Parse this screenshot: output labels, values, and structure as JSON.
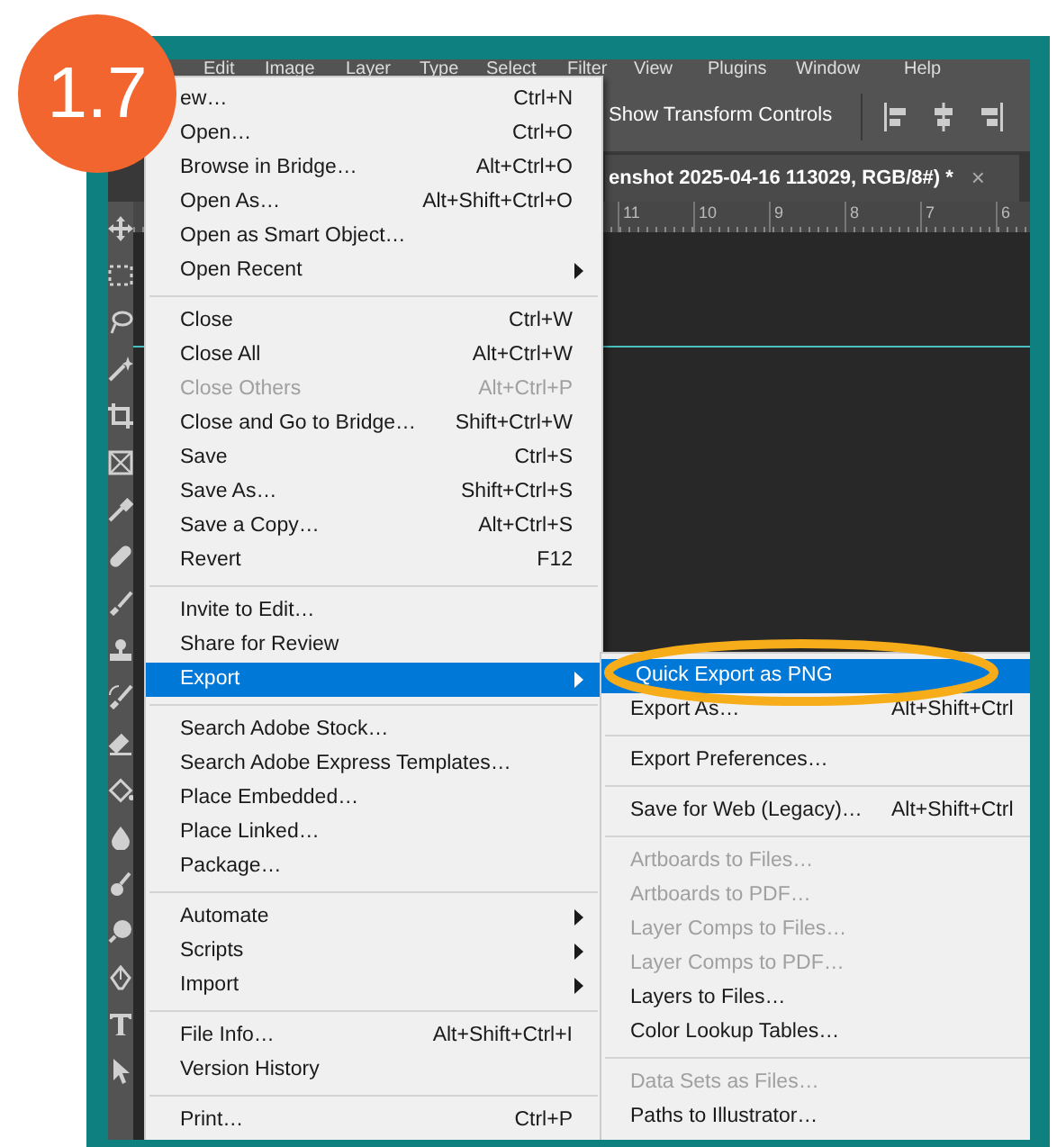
{
  "badge": "1.7",
  "menubar": [
    "Edit",
    "Image",
    "Layer",
    "Type",
    "Select",
    "Filter",
    "View",
    "Plugins",
    "Window",
    "Help"
  ],
  "options_bar": {
    "label": "Show Transform Controls"
  },
  "document_tab": {
    "title": "enshot 2025-04-16 113029, RGB/8#) *",
    "close": "×"
  },
  "ruler": [
    "11",
    "10",
    "9",
    "8",
    "7",
    "6"
  ],
  "file_menu": [
    {
      "kind": "item",
      "label": "ew…",
      "shortcut": "Ctrl+N",
      "submenu": false,
      "disabled": false,
      "selected": false
    },
    {
      "kind": "item",
      "label": "Open…",
      "shortcut": "Ctrl+O",
      "submenu": false,
      "disabled": false,
      "selected": false
    },
    {
      "kind": "item",
      "label": "Browse in Bridge…",
      "shortcut": "Alt+Ctrl+O",
      "submenu": false,
      "disabled": false,
      "selected": false
    },
    {
      "kind": "item",
      "label": "Open As…",
      "shortcut": "Alt+Shift+Ctrl+O",
      "submenu": false,
      "disabled": false,
      "selected": false
    },
    {
      "kind": "item",
      "label": "Open as Smart Object…",
      "submenu": false,
      "disabled": false,
      "selected": false
    },
    {
      "kind": "item",
      "label": "Open Recent",
      "submenu": true,
      "disabled": false,
      "selected": false
    },
    {
      "kind": "separator"
    },
    {
      "kind": "item",
      "label": "Close",
      "shortcut": "Ctrl+W",
      "submenu": false,
      "disabled": false,
      "selected": false
    },
    {
      "kind": "item",
      "label": "Close All",
      "shortcut": "Alt+Ctrl+W",
      "submenu": false,
      "disabled": false,
      "selected": false
    },
    {
      "kind": "item",
      "label": "Close Others",
      "shortcut": "Alt+Ctrl+P",
      "submenu": false,
      "disabled": true,
      "selected": false
    },
    {
      "kind": "item",
      "label": "Close and Go to Bridge…",
      "shortcut": "Shift+Ctrl+W",
      "submenu": false,
      "disabled": false,
      "selected": false
    },
    {
      "kind": "item",
      "label": "Save",
      "shortcut": "Ctrl+S",
      "submenu": false,
      "disabled": false,
      "selected": false
    },
    {
      "kind": "item",
      "label": "Save As…",
      "shortcut": "Shift+Ctrl+S",
      "submenu": false,
      "disabled": false,
      "selected": false
    },
    {
      "kind": "item",
      "label": "Save a Copy…",
      "shortcut": "Alt+Ctrl+S",
      "submenu": false,
      "disabled": false,
      "selected": false
    },
    {
      "kind": "item",
      "label": "Revert",
      "shortcut": "F12",
      "submenu": false,
      "disabled": false,
      "selected": false
    },
    {
      "kind": "separator"
    },
    {
      "kind": "item",
      "label": "Invite to Edit…",
      "submenu": false,
      "disabled": false,
      "selected": false
    },
    {
      "kind": "item",
      "label": "Share for Review",
      "submenu": false,
      "disabled": false,
      "selected": false
    },
    {
      "kind": "item",
      "label": "Export",
      "submenu": true,
      "disabled": false,
      "selected": true
    },
    {
      "kind": "separator"
    },
    {
      "kind": "item",
      "label": "Search Adobe Stock…",
      "submenu": false,
      "disabled": false,
      "selected": false
    },
    {
      "kind": "item",
      "label": "Search Adobe Express Templates…",
      "submenu": false,
      "disabled": false,
      "selected": false
    },
    {
      "kind": "item",
      "label": "Place Embedded…",
      "submenu": false,
      "disabled": false,
      "selected": false
    },
    {
      "kind": "item",
      "label": "Place Linked…",
      "submenu": false,
      "disabled": false,
      "selected": false
    },
    {
      "kind": "item",
      "label": "Package…",
      "submenu": false,
      "disabled": false,
      "selected": false
    },
    {
      "kind": "separator"
    },
    {
      "kind": "item",
      "label": "Automate",
      "submenu": true,
      "disabled": false,
      "selected": false
    },
    {
      "kind": "item",
      "label": "Scripts",
      "submenu": true,
      "disabled": false,
      "selected": false
    },
    {
      "kind": "item",
      "label": "Import",
      "submenu": true,
      "disabled": false,
      "selected": false
    },
    {
      "kind": "separator"
    },
    {
      "kind": "item",
      "label": "File Info…",
      "shortcut": "Alt+Shift+Ctrl+I",
      "submenu": false,
      "disabled": false,
      "selected": false
    },
    {
      "kind": "item",
      "label": "Version History",
      "submenu": false,
      "disabled": false,
      "selected": false
    },
    {
      "kind": "separator"
    },
    {
      "kind": "item",
      "label": "Print…",
      "shortcut": "Ctrl+P",
      "submenu": false,
      "disabled": false,
      "selected": false
    }
  ],
  "export_submenu": [
    {
      "kind": "item",
      "label": "Quick Export as PNG",
      "submenu": false,
      "disabled": false,
      "selected": true
    },
    {
      "kind": "item",
      "label": "Export As…",
      "shortcut": "Alt+Shift+Ctrl",
      "submenu": false,
      "disabled": false,
      "selected": false
    },
    {
      "kind": "separator"
    },
    {
      "kind": "item",
      "label": "Export Preferences…",
      "submenu": false,
      "disabled": false,
      "selected": false
    },
    {
      "kind": "separator"
    },
    {
      "kind": "item",
      "label": "Save for Web (Legacy)…",
      "shortcut": "Alt+Shift+Ctrl",
      "submenu": false,
      "disabled": false,
      "selected": false
    },
    {
      "kind": "separator"
    },
    {
      "kind": "item",
      "label": "Artboards to Files…",
      "submenu": false,
      "disabled": true,
      "selected": false
    },
    {
      "kind": "item",
      "label": "Artboards to PDF…",
      "submenu": false,
      "disabled": true,
      "selected": false
    },
    {
      "kind": "item",
      "label": "Layer Comps to Files…",
      "submenu": false,
      "disabled": true,
      "selected": false
    },
    {
      "kind": "item",
      "label": "Layer Comps to PDF…",
      "submenu": false,
      "disabled": true,
      "selected": false
    },
    {
      "kind": "item",
      "label": "Layers to Files…",
      "submenu": false,
      "disabled": false,
      "selected": false
    },
    {
      "kind": "item",
      "label": "Color Lookup Tables…",
      "submenu": false,
      "disabled": false,
      "selected": false
    },
    {
      "kind": "separator"
    },
    {
      "kind": "item",
      "label": "Data Sets as Files…",
      "submenu": false,
      "disabled": true,
      "selected": false
    },
    {
      "kind": "item",
      "label": "Paths to Illustrator…",
      "submenu": false,
      "disabled": false,
      "selected": false
    }
  ]
}
